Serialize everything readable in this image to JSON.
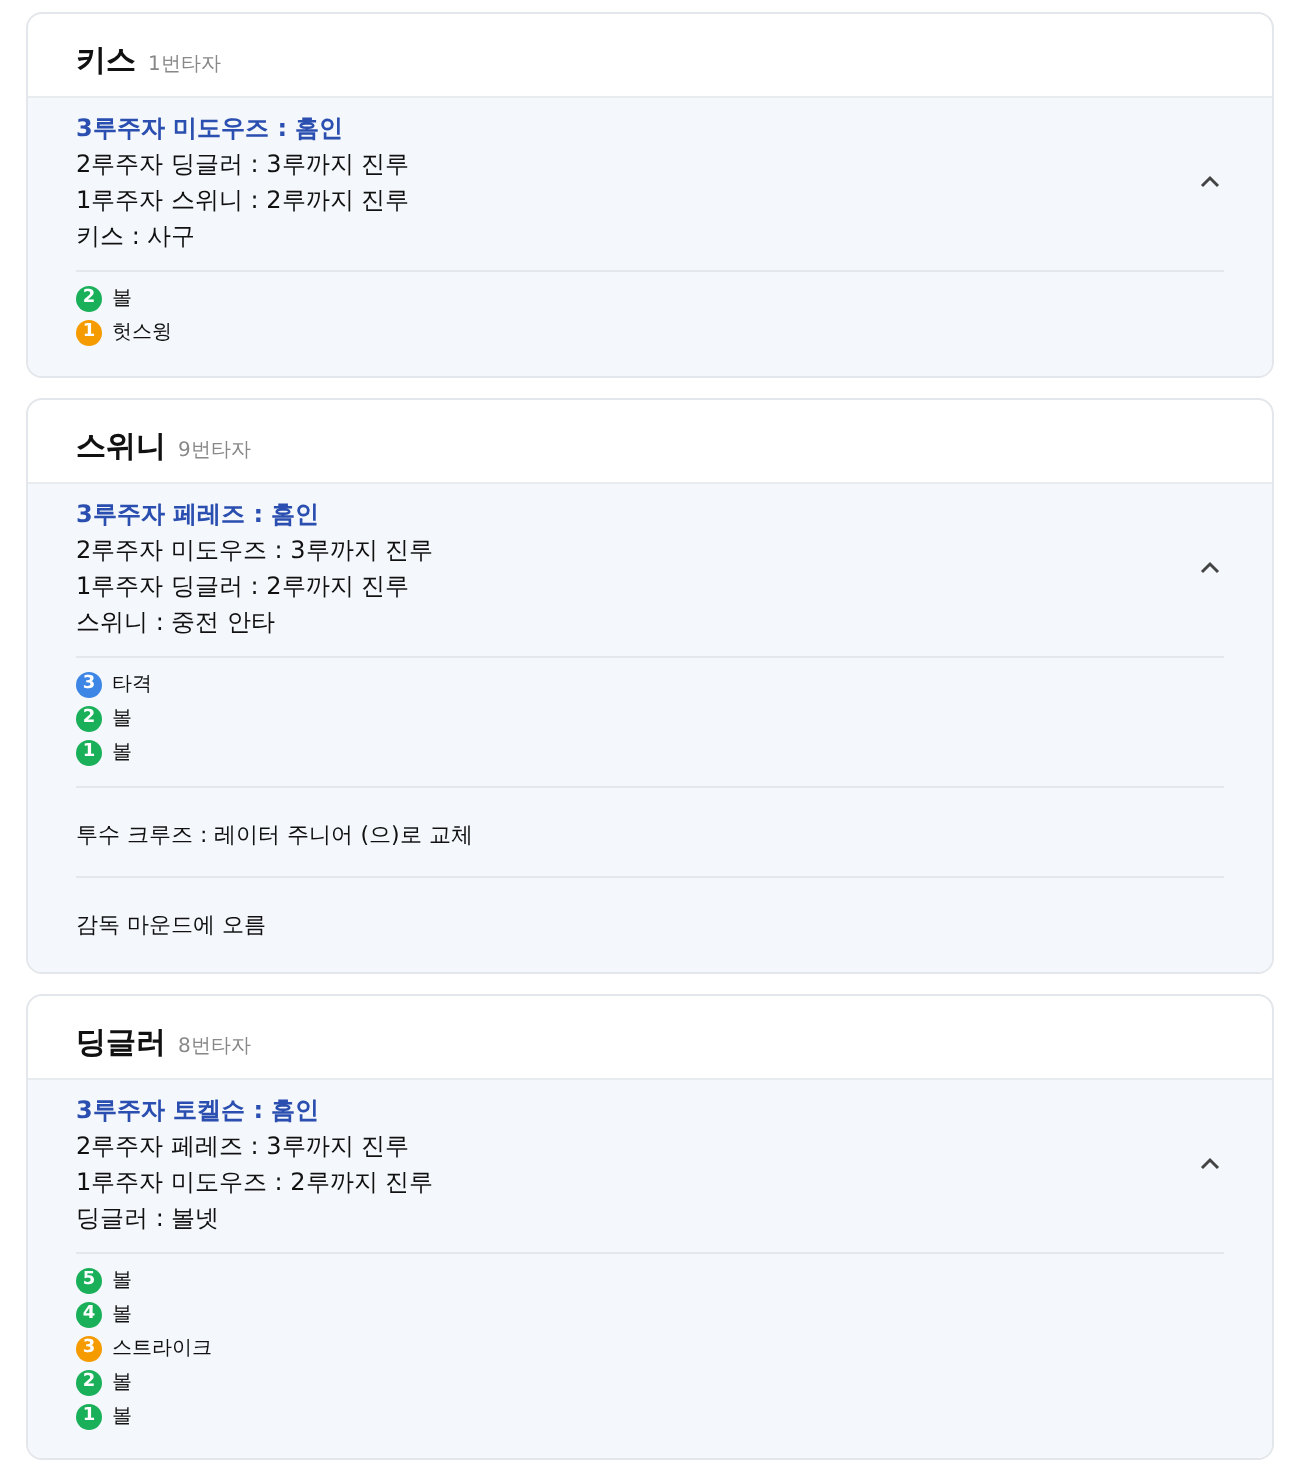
{
  "innings": [
    {
      "batter": "키스",
      "order": "1번타자",
      "expanded": true,
      "plays": [
        {
          "text": "3루주자 미도우즈 : 홈인",
          "highlight": true
        },
        {
          "text": "2루주자 딩글러 : 3루까지 진루",
          "highlight": false
        },
        {
          "text": "1루주자 스위니 : 2루까지 진루",
          "highlight": false
        },
        {
          "text": "키스 : 사구",
          "highlight": false
        }
      ],
      "pitches": [
        {
          "number": "2",
          "label": "볼",
          "color": "#1ab05a"
        },
        {
          "number": "1",
          "label": "헛스윙",
          "color": "#f59b00"
        }
      ]
    },
    {
      "batter": "스위니",
      "order": "9번타자",
      "expanded": true,
      "plays": [
        {
          "text": "3루주자 페레즈 : 홈인",
          "highlight": true
        },
        {
          "text": "2루주자 미도우즈 : 3루까지 진루",
          "highlight": false
        },
        {
          "text": "1루주자 딩글러 : 2루까지 진루",
          "highlight": false
        },
        {
          "text": "스위니 : 중전 안타",
          "highlight": false
        }
      ],
      "pitches": [
        {
          "number": "3",
          "label": "타격",
          "color": "#3d86e6"
        },
        {
          "number": "2",
          "label": "볼",
          "color": "#1ab05a"
        },
        {
          "number": "1",
          "label": "볼",
          "color": "#1ab05a"
        }
      ],
      "notes": [
        "투수 크루즈 : 레이터 주니어 (으)로 교체",
        "감독 마운드에 오름"
      ]
    },
    {
      "batter": "딩글러",
      "order": "8번타자",
      "expanded": true,
      "plays": [
        {
          "text": "3루주자 토켈슨 : 홈인",
          "highlight": true
        },
        {
          "text": "2루주자 페레즈 : 3루까지 진루",
          "highlight": false
        },
        {
          "text": "1루주자 미도우즈 : 2루까지 진루",
          "highlight": false
        },
        {
          "text": "딩글러 : 볼넷",
          "highlight": false
        }
      ],
      "pitches": [
        {
          "number": "5",
          "label": "볼",
          "color": "#1ab05a"
        },
        {
          "number": "4",
          "label": "볼",
          "color": "#1ab05a"
        },
        {
          "number": "3",
          "label": "스트라이크",
          "color": "#f59b00"
        },
        {
          "number": "2",
          "label": "볼",
          "color": "#1ab05a"
        },
        {
          "number": "1",
          "label": "볼",
          "color": "#1ab05a"
        }
      ]
    }
  ]
}
